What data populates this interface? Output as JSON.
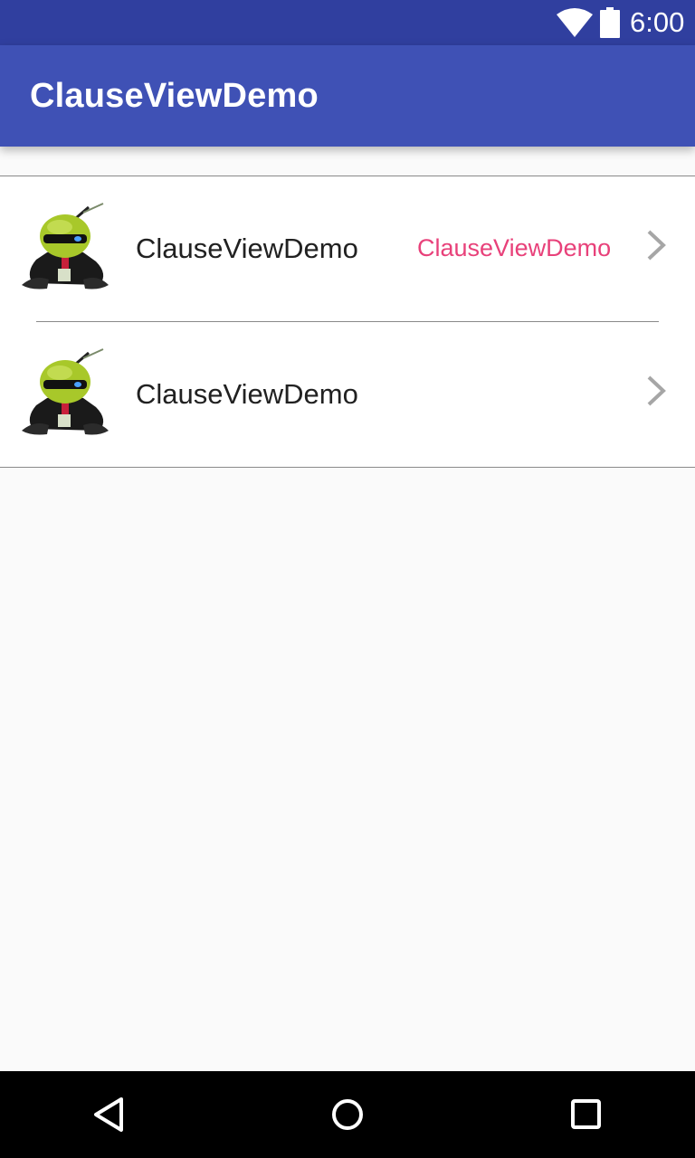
{
  "status_bar": {
    "time": "6:00",
    "icons": [
      "wifi-icon",
      "battery-icon"
    ]
  },
  "app_bar": {
    "title": "ClauseViewDemo",
    "color": "#3f51b5"
  },
  "list": {
    "items": [
      {
        "title": "ClauseViewDemo",
        "value": "ClauseViewDemo",
        "icon": "android-ninja-avatar",
        "trailing_icon": "chevron-right-icon"
      },
      {
        "title": "ClauseViewDemo",
        "value": "",
        "icon": "android-ninja-avatar",
        "trailing_icon": "chevron-right-icon"
      }
    ]
  },
  "colors": {
    "status_bar": "#303f9f",
    "primary": "#3f51b5",
    "accent_text": "#e8417a",
    "background": "#fafafa"
  },
  "nav_bar": {
    "buttons": [
      "back-icon",
      "home-icon",
      "recents-icon"
    ]
  }
}
